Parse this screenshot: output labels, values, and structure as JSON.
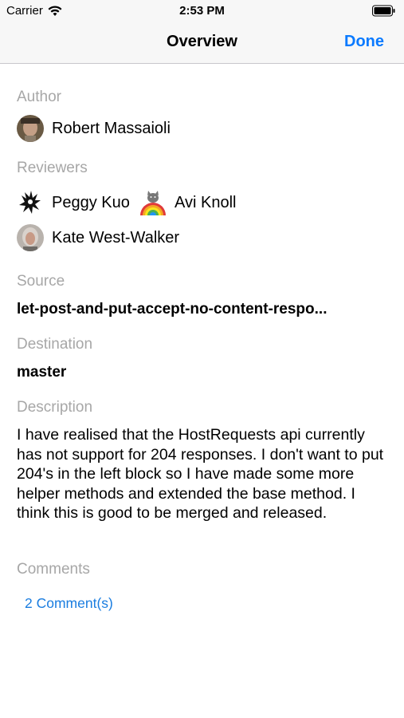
{
  "status_bar": {
    "carrier": "Carrier",
    "time": "2:53 PM"
  },
  "nav": {
    "title": "Overview",
    "done_label": "Done"
  },
  "author": {
    "label": "Author",
    "name": "Robert Massaioli"
  },
  "reviewers": {
    "label": "Reviewers",
    "people": [
      {
        "name": "Peggy Kuo",
        "icon": "dragon-avatar-icon"
      },
      {
        "name": "Avi Knoll",
        "icon": "rainbow-cat-avatar-icon"
      },
      {
        "name": "Kate West-Walker",
        "icon": "photo-avatar-icon"
      }
    ]
  },
  "source": {
    "label": "Source",
    "value": "let-post-and-put-accept-no-content-respo..."
  },
  "destination": {
    "label": "Destination",
    "value": "master"
  },
  "description": {
    "label": "Description",
    "text": "I have realised that the HostRequests api currently has not support for 204 responses. I don't want to put 204's in the left block so I have made some more helper methods and extended the base method. I think this is good to be merged and released."
  },
  "comments": {
    "label": "Comments",
    "link": "2 Comment(s)"
  },
  "colors": {
    "accent": "#0a7aff",
    "link": "#1a7de0",
    "label_gray": "#a7a7a7"
  }
}
